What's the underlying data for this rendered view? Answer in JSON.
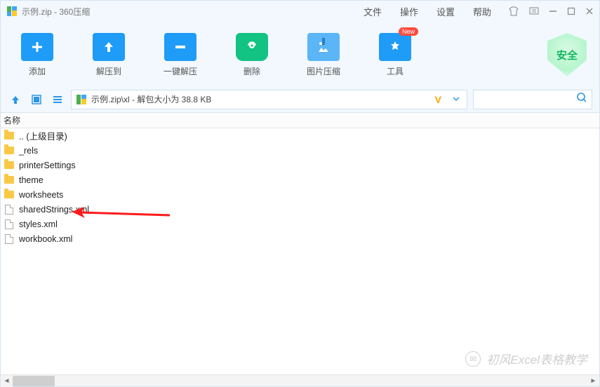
{
  "titlebar": {
    "title": "示例.zip - 360压缩",
    "menu": [
      "文件",
      "操作",
      "设置",
      "帮助"
    ]
  },
  "toolbar": {
    "items": [
      {
        "label": "添加",
        "icon": "plus"
      },
      {
        "label": "解压到",
        "icon": "up"
      },
      {
        "label": "一键解压",
        "icon": "dash"
      },
      {
        "label": "删除",
        "icon": "trash"
      },
      {
        "label": "图片压缩",
        "icon": "image"
      },
      {
        "label": "工具",
        "icon": "tool",
        "badge": "New"
      }
    ],
    "safe": "安全"
  },
  "pathbar": {
    "text": "示例.zip\\xl - 解包大小为 38.8 KB",
    "v": "V"
  },
  "columns": {
    "name": "名称"
  },
  "files": [
    {
      "name": ".. (上级目录)",
      "type": "folder"
    },
    {
      "name": "_rels",
      "type": "folder"
    },
    {
      "name": "printerSettings",
      "type": "folder"
    },
    {
      "name": "theme",
      "type": "folder"
    },
    {
      "name": "worksheets",
      "type": "folder"
    },
    {
      "name": "sharedStrings.xml",
      "type": "file"
    },
    {
      "name": "styles.xml",
      "type": "file"
    },
    {
      "name": "workbook.xml",
      "type": "file"
    }
  ],
  "watermark": "初风Excel表格教学"
}
